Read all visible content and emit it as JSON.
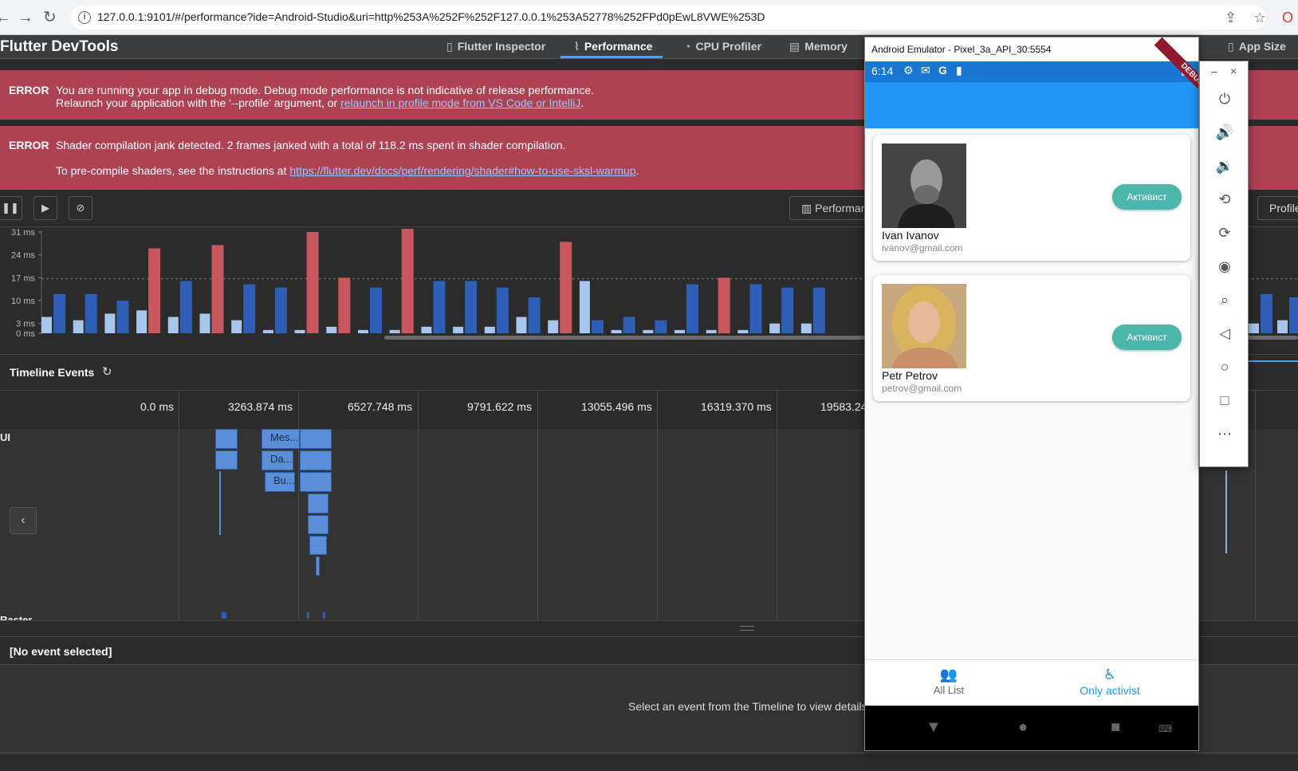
{
  "browser": {
    "url": "127.0.0.1:9101/#/performance?ide=Android-Studio&uri=http%253A%252F%252F127.0.0.1%253A52778%252FPd0pEwL8VWE%253D"
  },
  "devtools": {
    "title": "Flutter DevTools",
    "tabs": [
      {
        "label": "Flutter Inspector"
      },
      {
        "label": "Performance"
      },
      {
        "label": "CPU Profiler"
      },
      {
        "label": "Memory"
      },
      {
        "label": "App Size"
      }
    ]
  },
  "errors": [
    {
      "label": "ERROR",
      "line1": "You are running your app in debug mode. Debug mode performance is not indicative of release performance.",
      "line2_prefix": "Relaunch your application with the '--profile' argument, or ",
      "line2_link": "relaunch in profile mode from VS Code or IntelliJ",
      "line2_suffix": "."
    },
    {
      "label": "ERROR",
      "line1": "Shader compilation jank detected. 2 frames janked with a total of 118.2 ms spent in shader compilation.",
      "line2_prefix": "To pre-compile shaders, see the instructions at ",
      "line2_link": "https://flutter.dev/docs/perf/rendering/shader#how-to-use-sksl-warmup",
      "line2_suffix": "."
    }
  ],
  "controls": {
    "performance_overlay": "Performance Overlay",
    "profile": "Profile"
  },
  "chart_data": {
    "type": "bar",
    "yticks": [
      "31 ms",
      "24 ms",
      "17 ms",
      "10 ms",
      "3 ms",
      "0 ms"
    ],
    "ylim": [
      0,
      31
    ],
    "colors": {
      "ui": "#a7c6ed",
      "raster": "#2d5fb7",
      "jank": "#c9575e"
    },
    "frames": [
      {
        "ui": 5,
        "raster": 12
      },
      {
        "ui": 4,
        "raster": 12
      },
      {
        "ui": 6,
        "raster": 10
      },
      {
        "ui": 7,
        "raster": 26,
        "jank": true
      },
      {
        "ui": 5,
        "raster": 16
      },
      {
        "ui": 6,
        "raster": 27,
        "jank": true
      },
      {
        "ui": 4,
        "raster": 15
      },
      {
        "ui": 1,
        "raster": 14
      },
      {
        "ui": 1,
        "raster": 31,
        "jank": true
      },
      {
        "ui": 2,
        "raster": 17,
        "jank": true
      },
      {
        "ui": 1,
        "raster": 14
      },
      {
        "ui": 1,
        "raster": 32,
        "jank": true
      },
      {
        "ui": 2,
        "raster": 16
      },
      {
        "ui": 2,
        "raster": 16
      },
      {
        "ui": 2,
        "raster": 14
      },
      {
        "ui": 5,
        "raster": 11
      },
      {
        "ui": 4,
        "raster": 28,
        "jank": true
      },
      {
        "ui": 16,
        "raster": 4
      },
      {
        "ui": 1,
        "raster": 5
      },
      {
        "ui": 1,
        "raster": 4
      },
      {
        "ui": 1,
        "raster": 15
      },
      {
        "ui": 1,
        "raster": 17,
        "jank": true
      },
      {
        "ui": 1,
        "raster": 15
      },
      {
        "ui": 3,
        "raster": 14
      },
      {
        "ui": 3,
        "raster": 14
      }
    ],
    "right_frames": [
      {
        "ui": 3,
        "raster": 12
      },
      {
        "ui": 4,
        "raster": 11
      }
    ]
  },
  "timeline": {
    "title": "Timeline Events",
    "ticks": [
      "0.0 ms",
      "3263.874 ms",
      "6527.748 ms",
      "9791.622 ms",
      "13055.496 ms",
      "16319.370 ms",
      "19583.244 ms"
    ],
    "ui_label": "UI",
    "raster_label": "Raster",
    "flame_labels": [
      "Mes...",
      "Da...",
      "Bu..."
    ]
  },
  "details": {
    "header": "[No event selected]",
    "hint": "Select an event from the Timeline to view details"
  },
  "emulator": {
    "title": "Android Emulator - Pixel_3a_API_30:5554",
    "time": "6:14",
    "debug_label": "DEBUG",
    "cards": [
      {
        "name": "Ivan Ivanov",
        "email": "ivanov@gmail.com",
        "button": "Активист"
      },
      {
        "name": "Petr Petrov",
        "email": "petrov@gmail.com",
        "button": "Активист"
      }
    ],
    "nav": [
      {
        "label": "All List",
        "icon": "people-icon"
      },
      {
        "label": "Only activist",
        "icon": "accessibility-icon"
      }
    ],
    "active_color": "#2196f3"
  }
}
